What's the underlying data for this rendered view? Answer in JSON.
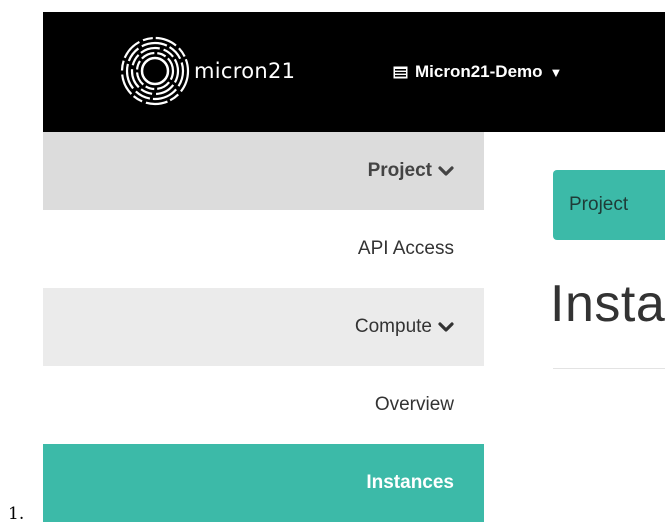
{
  "list_marker": "1.",
  "brand": {
    "name": "micron21",
    "logo_icon": "concentric-circles-logo"
  },
  "project_picker": {
    "label": "Micron21-Demo",
    "icon": "server-icon",
    "caret": "▼"
  },
  "sidebar": {
    "project_panel": {
      "label": "Project"
    },
    "api_access": {
      "label": "API Access"
    },
    "compute_panel": {
      "label": "Compute"
    },
    "overview": {
      "label": "Overview"
    },
    "instances": {
      "label": "Instances",
      "active": true
    }
  },
  "main": {
    "breadcrumb": "Project",
    "page_title": "Instances"
  },
  "colors": {
    "topbar": "#000000",
    "accent": "#3cbaa8",
    "panel_active": "#dcdcdc",
    "panel_inactive": "#ebebeb"
  }
}
